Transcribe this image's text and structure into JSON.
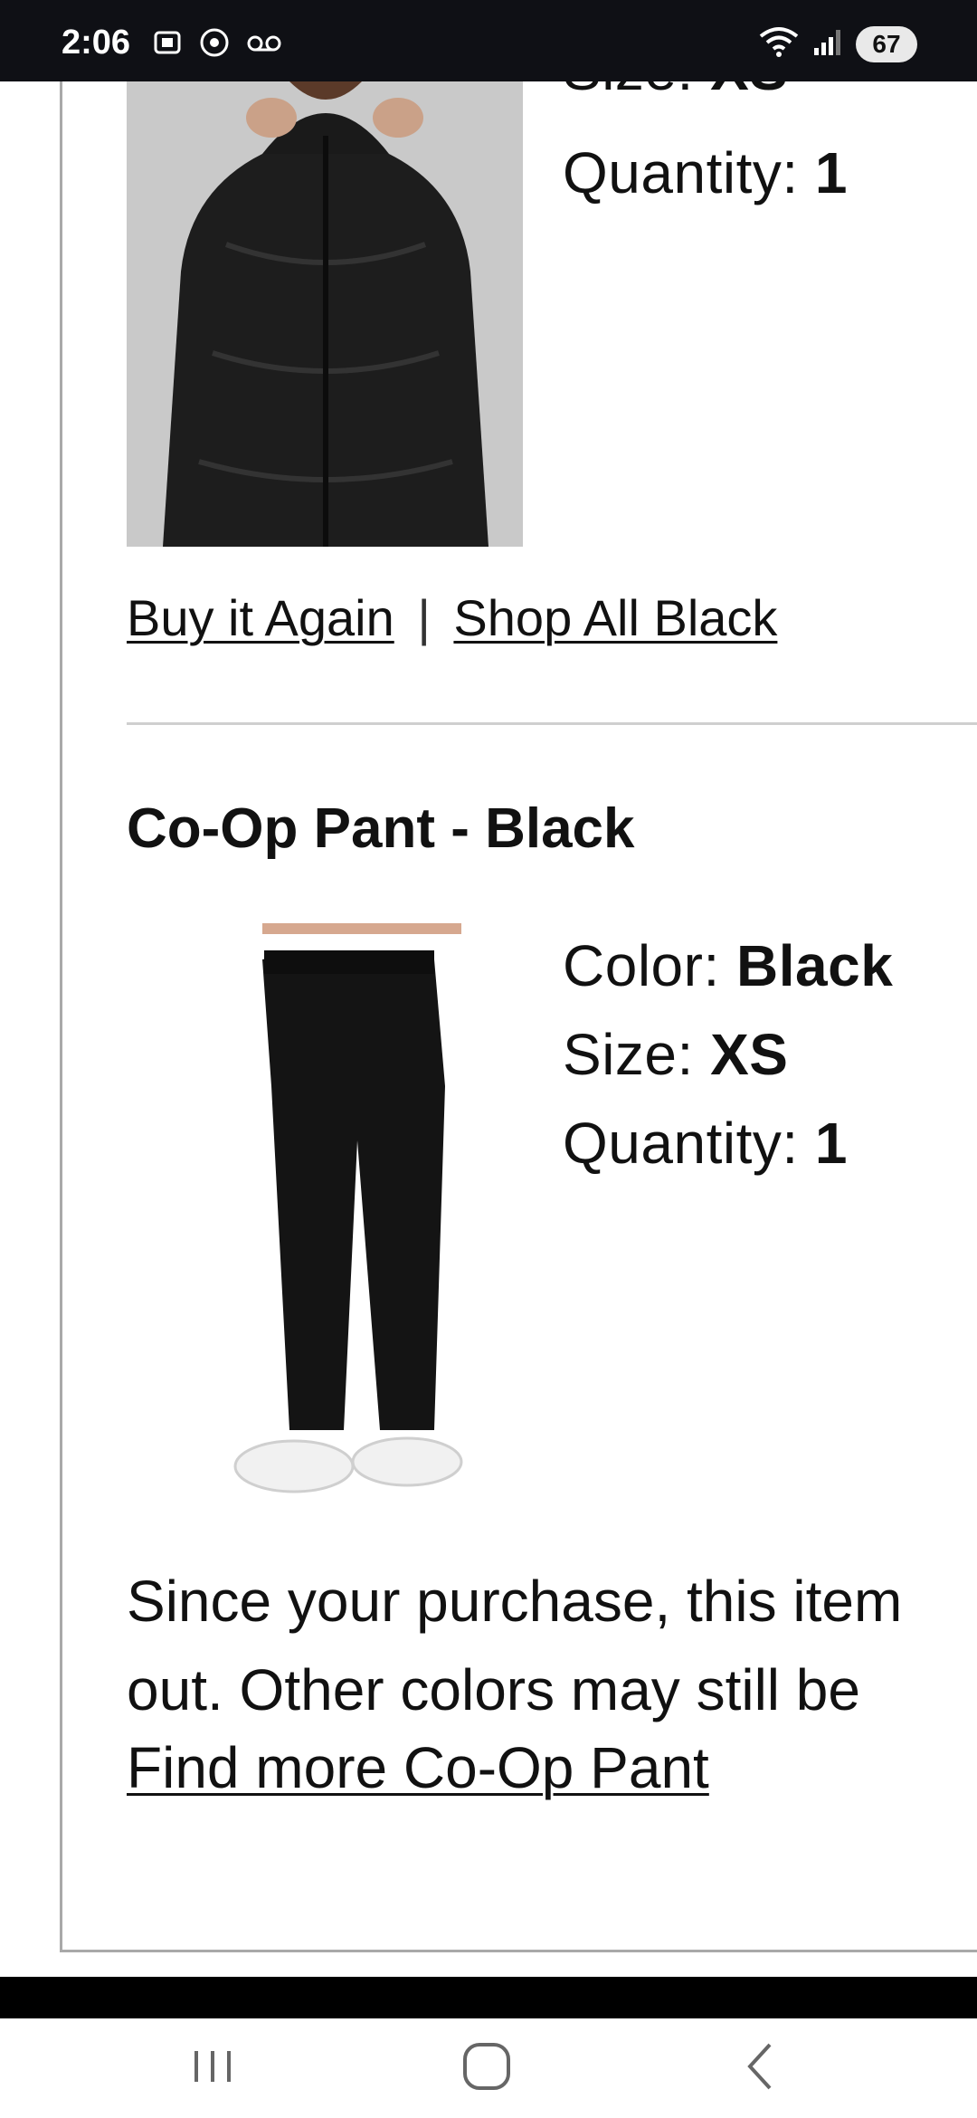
{
  "status_bar": {
    "time": "2:06",
    "left_icons": [
      "screenshot-icon",
      "chrome-icon",
      "voicemail-icon"
    ],
    "right_icons": [
      "wifi-icon",
      "signal-icon"
    ],
    "battery": "67"
  },
  "top_item": {
    "size_label": "Size:",
    "size_value": "XS",
    "quantity_label": "Quantity:",
    "quantity_value": "1",
    "links": {
      "buy_again": "Buy it Again",
      "separator": "|",
      "shop_all": "Shop All Black"
    }
  },
  "second_item": {
    "title": "Co-Op Pant - Black",
    "color_label": "Color:",
    "color_value": "Black",
    "size_label": "Size:",
    "size_value": "XS",
    "quantity_label": "Quantity:",
    "quantity_value": "1",
    "note_line1": "Since your purchase, this item",
    "note_line2": "out. Other colors may still be",
    "find_more": "Find more Co-Op Pant"
  },
  "nav": {
    "icons": [
      "recent-apps-icon",
      "home-icon",
      "back-icon"
    ]
  },
  "colors": {
    "status_bg": "#0f1015",
    "border": "#a9a9a9",
    "divider": "#cfcfcf"
  }
}
